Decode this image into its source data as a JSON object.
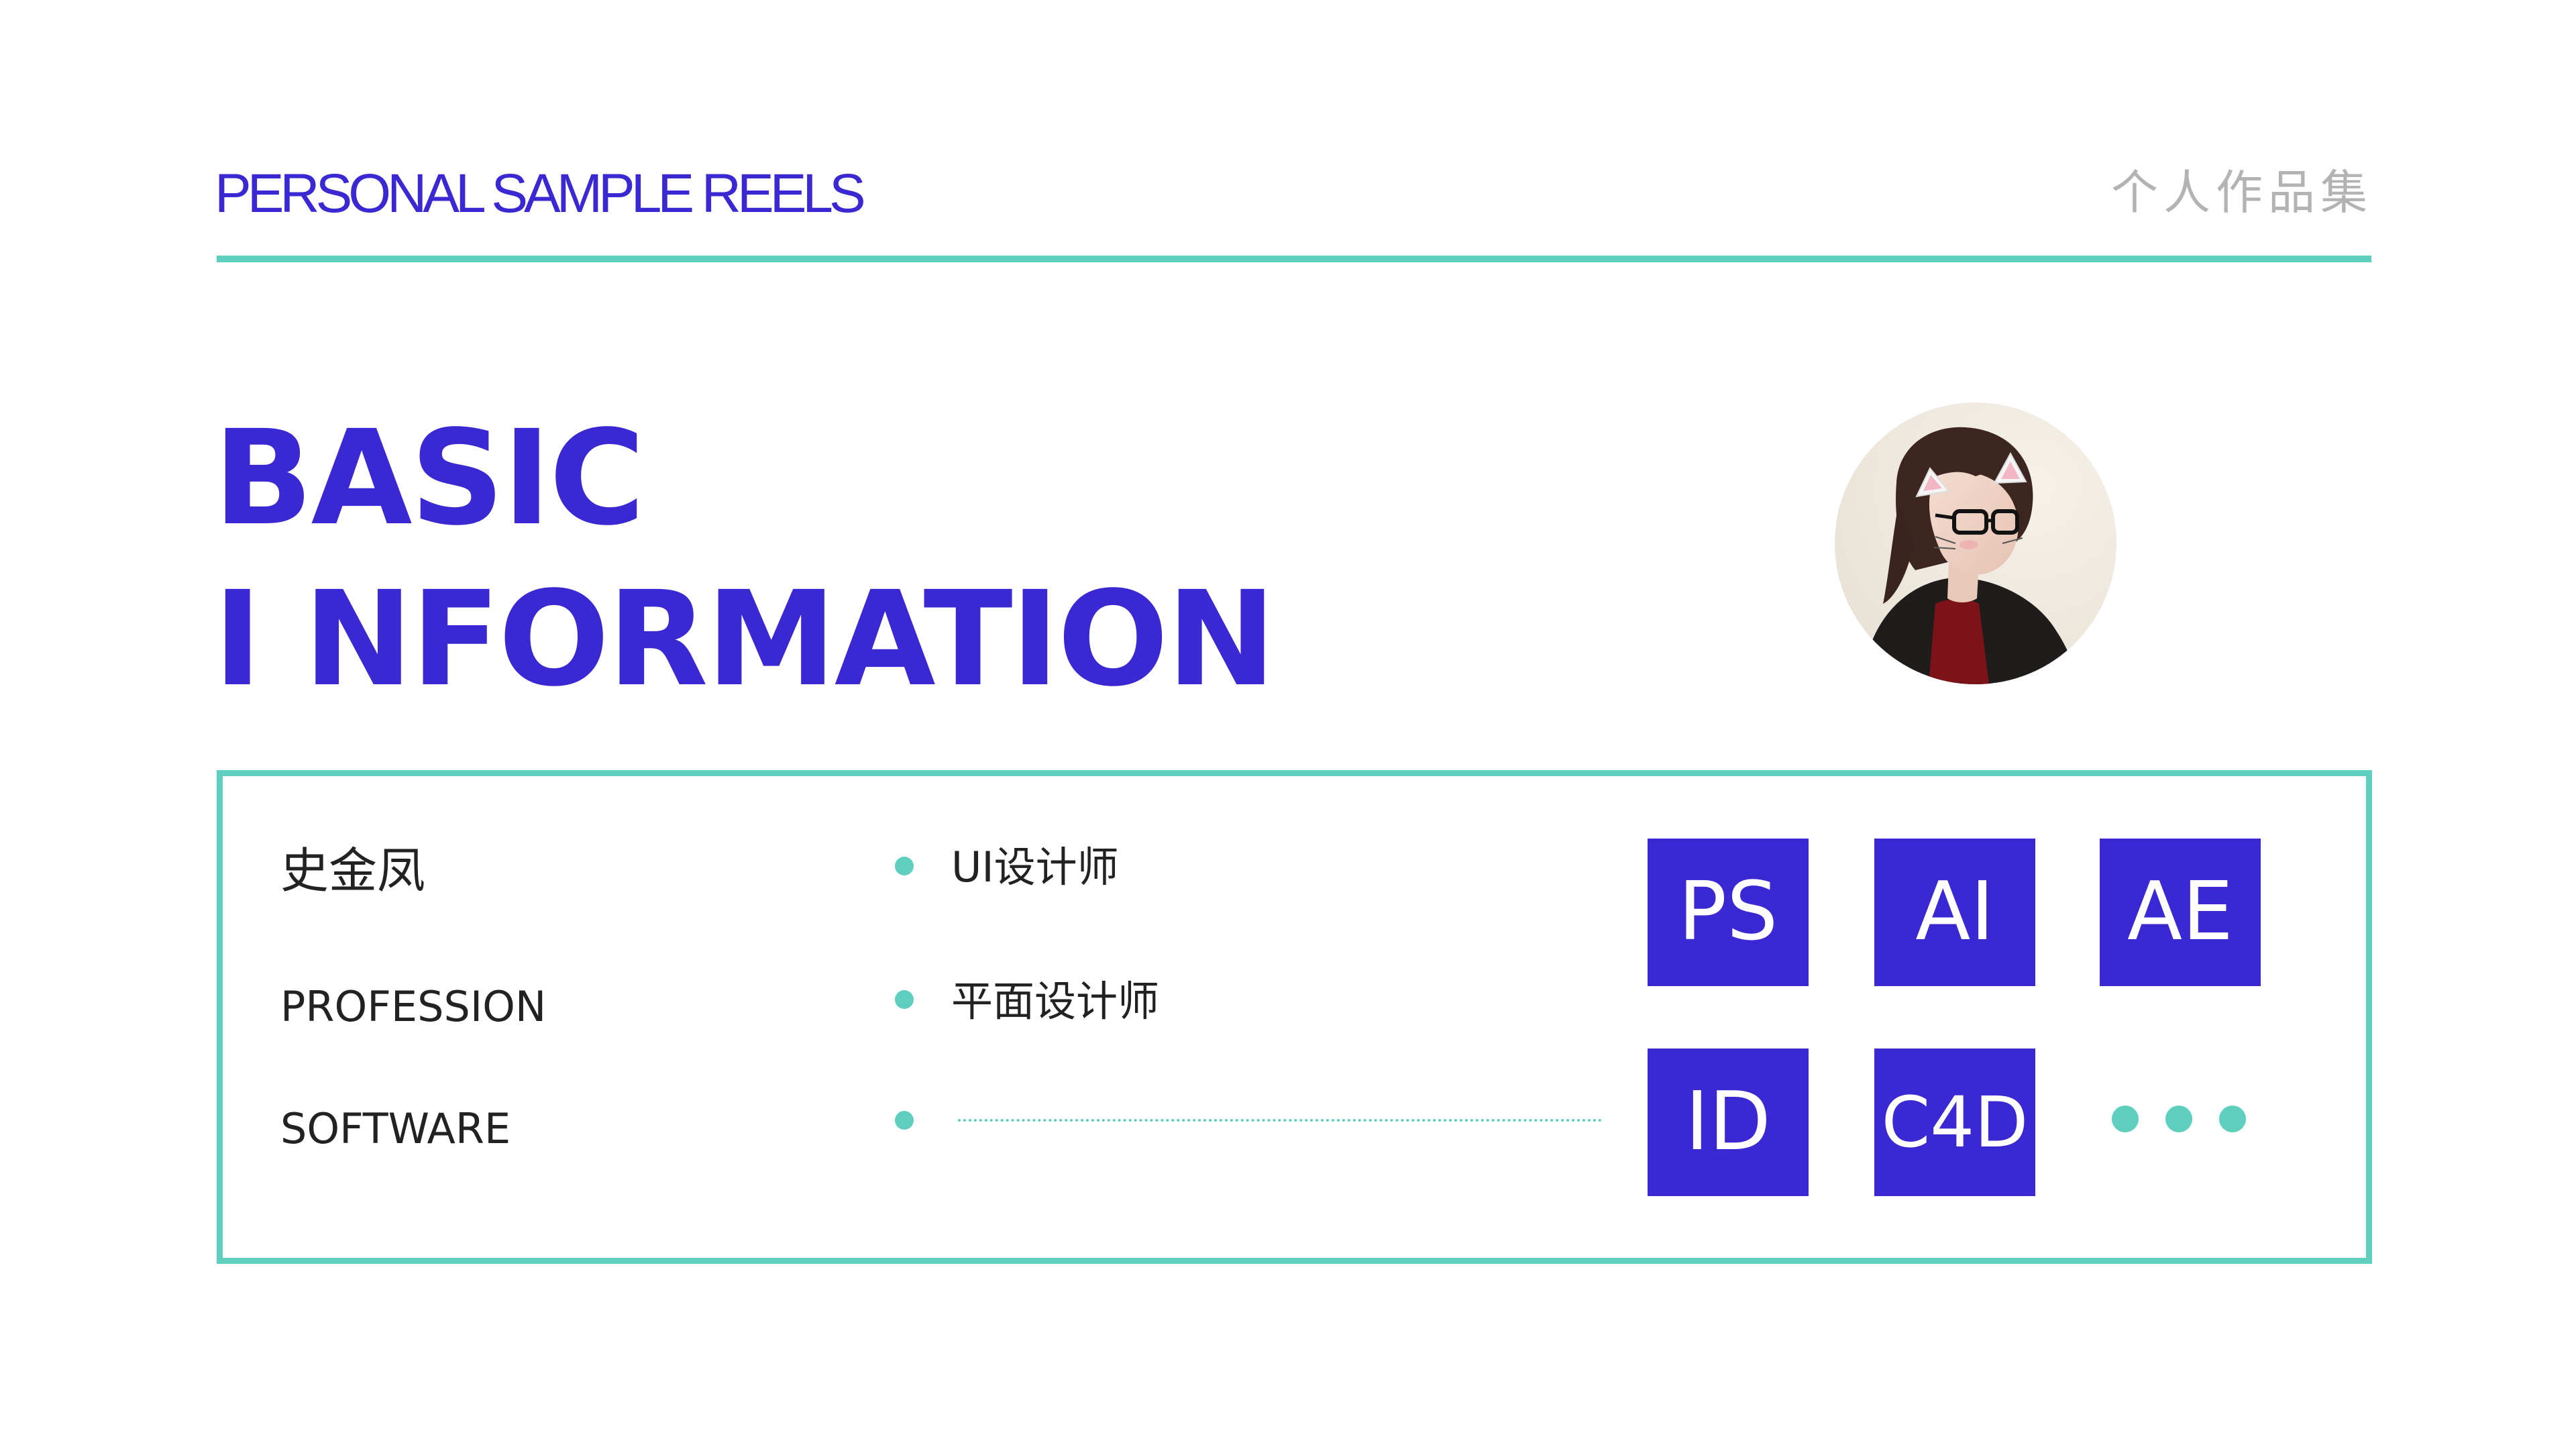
{
  "header": {
    "title": "PERSONAL SAMPLE  REELS",
    "subtitle": "个人作品集"
  },
  "hero": {
    "line1": "BASIC",
    "line2": "I NFORMATION"
  },
  "profile": {
    "name": "史金凤",
    "labels": {
      "profession": "PROFESSION",
      "software": "SOFTWARE"
    },
    "roles": [
      "UI设计师",
      "平面设计师"
    ]
  },
  "software": {
    "tiles": [
      "PS",
      "AI",
      "AE",
      "ID",
      "C4D"
    ],
    "more_icon": "ellipsis-dots-icon"
  },
  "colors": {
    "accent_purple": "#3a29d3",
    "accent_teal": "#5ecfbe",
    "subtitle_gray": "#b3b3b3",
    "text_dark": "#222222"
  }
}
